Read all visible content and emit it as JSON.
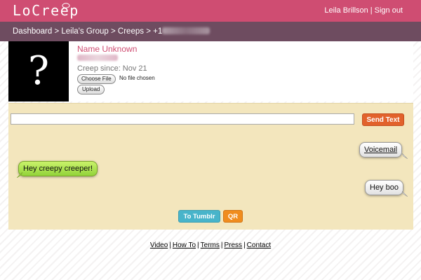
{
  "header": {
    "logo": "LoCreep",
    "user_name": "Leila Brillson",
    "separator": "|",
    "sign_out": "Sign out",
    "colors": {
      "brand": "#cf4d72",
      "crumb_bar": "#6e4c60"
    }
  },
  "breadcrumb": {
    "items": [
      "Dashboard",
      "Leila's Group",
      "Creeps",
      "+1"
    ],
    "separator": ">"
  },
  "profile": {
    "avatar_glyph": "?",
    "name": "Name Unknown",
    "since": "Creep since: Nov 21",
    "choose_file": "Choose File",
    "no_file": "No file chosen",
    "upload": "Upload"
  },
  "conversation": {
    "input_value": "",
    "send_label": "Send Text",
    "messages": [
      {
        "text": "Voicemail",
        "direction": "outgoing"
      },
      {
        "text": "Hey creepy creeper!",
        "direction": "incoming"
      },
      {
        "text": "Hey boo",
        "direction": "outgoing"
      }
    ],
    "tumblr_label": "To Tumblr",
    "qr_label": "QR",
    "colors": {
      "panel": "#f3e6bd",
      "send": "#e2622c",
      "tumblr": "#48b4ca",
      "qr": "#f08c1e",
      "incoming": "#a9e04e"
    }
  },
  "footer": {
    "links": [
      "Video",
      "How To",
      "Terms",
      "Press",
      "Contact"
    ],
    "separator": "|"
  }
}
